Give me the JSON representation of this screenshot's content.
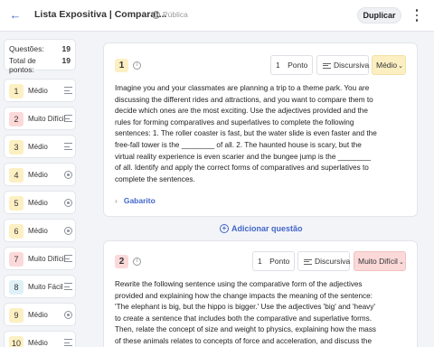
{
  "header": {
    "title": "Lista Expositiva | Comparat...",
    "visibility": "Pública",
    "duplicate_label": "Duplicar"
  },
  "summary": {
    "questions_label": "Questões:",
    "questions_value": "19",
    "points_label": "Total de pontos:",
    "points_value": "19"
  },
  "nav_items": [
    {
      "number": "1",
      "difficulty": "Médio",
      "level": "medio",
      "type": "lines"
    },
    {
      "number": "2",
      "difficulty": "Muito Difícil",
      "level": "dificil",
      "type": "lines"
    },
    {
      "number": "3",
      "difficulty": "Médio",
      "level": "medio",
      "type": "lines"
    },
    {
      "number": "4",
      "difficulty": "Médio",
      "level": "medio",
      "type": "radio"
    },
    {
      "number": "5",
      "difficulty": "Médio",
      "level": "medio",
      "type": "radio"
    },
    {
      "number": "6",
      "difficulty": "Médio",
      "level": "medio",
      "type": "radio"
    },
    {
      "number": "7",
      "difficulty": "Muito Difícil",
      "level": "dificil",
      "type": "lines"
    },
    {
      "number": "8",
      "difficulty": "Muito Fácil",
      "level": "facil",
      "type": "lines"
    },
    {
      "number": "9",
      "difficulty": "Médio",
      "level": "medio",
      "type": "radio"
    },
    {
      "number": "10",
      "difficulty": "Médio",
      "level": "medio",
      "type": "lines"
    }
  ],
  "questions": [
    {
      "number": "1",
      "points_value": "1",
      "points_label": "Ponto",
      "type_label": "Discursiva",
      "difficulty": "Médio",
      "text": "Imagine you and your classmates are planning a trip to a theme park. You are discussing the different rides and attractions, and you want to compare them to decide which ones are the most exciting. Use the adjectives provided and the rules for forming comparatives and superlatives to complete the following sentences: 1. The roller coaster is fast, but the water slide is even faster and the free-fall tower is the ________ of all. 2. The haunted house is scary, but the virtual reality experience is even scarier and the bungee jump is the ________ of all. Identify and apply the correct forms of comparatives and superlatives to complete the sentences.",
      "answer_label": "Gabarito"
    },
    {
      "number": "2",
      "points_value": "1",
      "points_label": "Ponto",
      "type_label": "Discursiva",
      "difficulty": "Muito Difícil",
      "text": "Rewrite the following sentence using the comparative form of the adjectives provided and explaining how the change impacts the meaning of the sentence: 'The elephant is big, but the hippo is bigger.' Use the adjectives 'big' and 'heavy' to create a sentence that includes both the comparative and superlative forms. Then, relate the concept of size and weight to physics, explaining how the mass of these animals relates to concepts of force and acceleration, and discuss the implications"
    }
  ],
  "add_question_label": "Adicionar questão"
}
